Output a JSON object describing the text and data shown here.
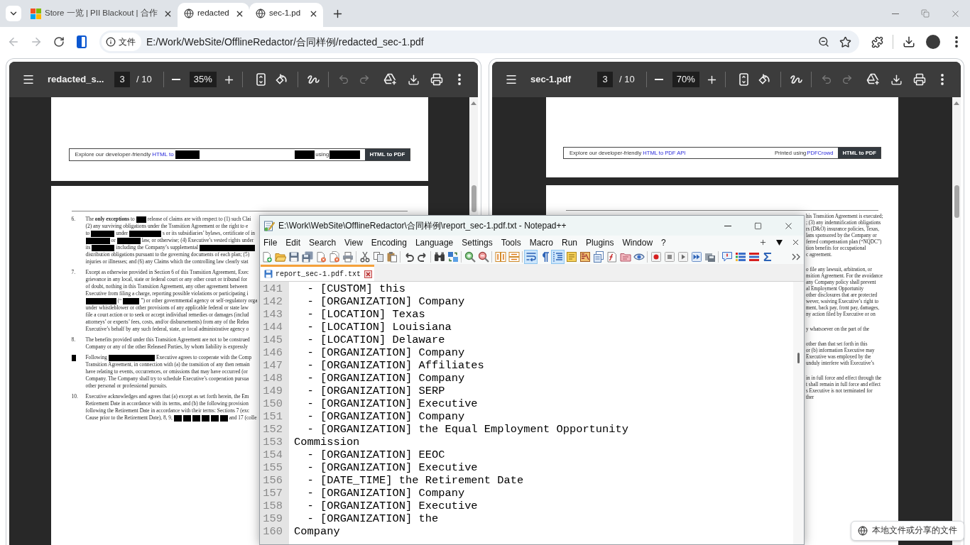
{
  "browser": {
    "tabs": [
      {
        "kind": "store",
        "title": "Store 一览 | PII Blackout | 合作",
        "selected": false
      },
      {
        "kind": "page",
        "title": "redacted",
        "selected": true
      },
      {
        "kind": "page",
        "title": "sec-1.pd",
        "selected": true
      }
    ],
    "nav_buttons": [
      {
        "kind": "back",
        "disabled": true
      },
      {
        "kind": "forward",
        "disabled": true
      },
      {
        "kind": "reload",
        "disabled": false
      }
    ],
    "address_bar": {
      "chip": "文件",
      "url": "E:/Work/WebSite/OfflineRedactor/合同样例/redacted_sec-1.pdf",
      "bookmarked": false
    }
  },
  "panes": [
    {
      "title": "redacted_s...",
      "page": "3",
      "page_total": "/ 10",
      "zoom": "35%",
      "history": [
        {
          "kind": "undo",
          "disabled": true
        },
        {
          "kind": "redo",
          "disabled": true
        }
      ],
      "footer": {
        "left": [
          "Explore our developer-friendly",
          {
            "kind": "link",
            "text": "HTML to"
          },
          {
            "kind": "redaction"
          }
        ],
        "right": [
          {
            "kind": "redaction"
          },
          "using",
          {
            "kind": "redaction"
          }
        ],
        "badge": "HTML to PDF"
      },
      "page_text": {
        "kind": "clauses",
        "paragraphs": [
          {
            "number": "6.",
            "lines": [
              [
                "The **only exceptions** to",
                {
                  "kind": "redaction"
                },
                "release of claims are with respect to (1) such Clai"
              ],
              [
                "(2) any surviving obligations under the Transition Agreement or the right to e"
              ],
              [
                "to",
                {
                  "kind": "redaction"
                },
                "under",
                {
                  "kind": "redaction"
                },
                "s or its subsidiaries’ bylaws, certificate of in"
              ],
              [
                {
                  "kind": "redaction"
                },
                "or",
                {
                  "kind": "redaction"
                },
                "law, or otherwise; (4) Executive’s vested rights under"
              ],
              [
                "its",
                {
                  "kind": "redaction"
                },
                "including the Company’s supplemental",
                {
                  "kind": "redaction"
                }
              ],
              [
                "distribution obligations pursuant to the governing documents of each plan; (5)"
              ],
              [
                "injuries or illnesses; and (6) any Claims which the controlling law clearly stat"
              ]
            ]
          },
          {
            "number": "7.",
            "lines": [
              [
                "Except as otherwise provided in Section 6 of this Transition Agreement, Exec"
              ],
              [
                "grievance in any local, state or federal court or any other court or tribunal for"
              ],
              [
                "of doubt, nothing in this Transition Agreement, any other agreement between"
              ],
              [
                "Executive from filing a charge, reporting possible violations or participating i"
              ],
              [
                {
                  "kind": "redaction"
                },
                "(“",
                {
                  "kind": "redaction"
                },
                "”) or other governmental agency or self-regulatory orga"
              ],
              [
                "under whistleblower or other provisions of any applicable federal or state law"
              ],
              [
                "file a court action or to seek or accept individual remedies or damages (includ"
              ],
              [
                "attorneys’ or experts’ fees, costs, and/or disbursements) from any of the Relea"
              ],
              [
                "Executive’s behalf by any such federal, state, or local administrative agency o"
              ]
            ]
          },
          {
            "number": "8.",
            "lines": [
              [
                "The benefits provided under this Transition Agreement are not to be construed"
              ],
              [
                "Company or any of the other Released Parties, by whom liability is expressly"
              ]
            ]
          },
          {
            "number": {
              "kind": "redaction"
            },
            "lines": [
              [
                "Following",
                {
                  "kind": "redaction"
                },
                "Executive agrees to cooperate with the Comp"
              ],
              [
                "Transition Agreement, in connection with (a) the transition of any then remain"
              ],
              [
                "have relating to events, occurrences, or omissions that may have occurred (or"
              ],
              [
                "Company. The Company shall try to schedule Executive’s cooperation pursua"
              ],
              [
                "other personal or professional pursuits."
              ]
            ]
          },
          {
            "number": "10.",
            "lines": [
              [
                "Executive acknowledges and agrees that (a) except as set forth herein, the Em"
              ],
              [
                "Retirement Date in accordance with its terms, and (b) the following provision"
              ],
              [
                "following the Retirement Date in accordance with their terms: Sections 7 (exc"
              ],
              [
                "Cause prior to the Retirement Date), 8, 9,",
                {
                  "kind": "redaction"
                },
                {
                  "kind": "redaction"
                },
                {
                  "kind": "redaction"
                },
                {
                  "kind": "redaction"
                },
                {
                  "kind": "redaction"
                },
                {
                  "kind": "redaction"
                },
                "and 17 (colle"
              ]
            ]
          }
        ]
      }
    },
    {
      "title": "sec-1.pdf",
      "page": "3",
      "page_total": "/ 10",
      "zoom": "70%",
      "history": [
        {
          "kind": "undo",
          "disabled": true
        },
        {
          "kind": "redo",
          "disabled": true
        }
      ],
      "footer": {
        "left": [
          "Explore our developer-friendly",
          {
            "kind": "link",
            "text": "HTML to PDF API"
          }
        ],
        "right": [
          "Printed using",
          {
            "kind": "link",
            "text": "PDFCrowd"
          }
        ],
        "badge": "HTML to PDF"
      },
      "page_text": {
        "kind": "fragments",
        "paragraphs": [
          {
            "lines": [
              "his Transition Agreement is executed;",
              "; (3) any indemnification obligations",
              "rs (D&O) insurance policies, Texas,",
              "lans sponsored by the Company or",
              "ferred compensation plan (“NQDC”)",
              "tion benefits for occupational",
              "c agreement."
            ]
          },
          {
            "lines": [
              "o file any lawsuit, arbitration, or",
              "nsition Agreement. For the avoidance",
              "any Company policy shall prevent",
              "al Employment Opportunity",
              "other disclosures that are protected",
              "wever, waiving Executive’s right to",
              "ment, back pay, front pay, damages,",
              "ny action filed by Executive or on"
            ]
          },
          {
            "lines": [
              "y whatsoever on the part of the"
            ]
          },
          {
            "lines": [
              "other than that set forth in this",
              "or (b) information Executive may",
              "Executive was employed by the",
              "unduly interfere with Executive’s"
            ]
          },
          {
            "lines": [
              "in in full force and effect through the",
              "t shall remain in full force and effect",
              "s Executive is not terminated for",
              "ther"
            ]
          }
        ]
      }
    }
  ],
  "notepad": {
    "title": "E:\\Work\\WebSite\\OfflineRedactor\\合同样例\\report_sec-1.pdf.txt - Notepad++",
    "menu": [
      "File",
      "Edit",
      "Search",
      "View",
      "Encoding",
      "Language",
      "Settings",
      "Tools",
      "Macro",
      "Run",
      "Plugins",
      "Window",
      "?"
    ],
    "toolbar": [
      {
        "kind": "new",
        "on": false
      },
      {
        "kind": "open",
        "on": false
      },
      {
        "kind": "save",
        "on": false
      },
      {
        "kind": "save_all",
        "on": false
      },
      {
        "kind": "close",
        "on": false
      },
      {
        "kind": "close_all",
        "on": false
      },
      {
        "kind": "print",
        "on": false
      },
      {
        "kind": "cut",
        "on": false
      },
      {
        "kind": "copy",
        "on": false
      },
      {
        "kind": "paste",
        "on": false
      },
      {
        "kind": "undo",
        "on": false
      },
      {
        "kind": "redo",
        "on": false
      },
      {
        "kind": "find",
        "on": false
      },
      {
        "kind": "replace",
        "on": false
      },
      {
        "kind": "zoom_in",
        "on": false
      },
      {
        "kind": "zoom_out",
        "on": false
      },
      {
        "kind": "sync_v",
        "on": false
      },
      {
        "kind": "sync_h",
        "on": false
      },
      {
        "kind": "wrap",
        "on": true
      },
      {
        "kind": "all_chars",
        "on": false
      },
      {
        "kind": "indent",
        "on": true
      },
      {
        "kind": "udl",
        "on": false
      },
      {
        "kind": "doc_map",
        "on": false
      },
      {
        "kind": "doc_list",
        "on": false
      },
      {
        "kind": "func_list",
        "on": false
      },
      {
        "kind": "folder_ws",
        "on": false
      },
      {
        "kind": "monitor",
        "on": false
      },
      {
        "kind": "rec",
        "on": false
      },
      {
        "kind": "stop",
        "on": false
      },
      {
        "kind": "play",
        "on": false
      },
      {
        "kind": "play_multi",
        "on": false
      },
      {
        "kind": "save_macro",
        "on": false
      },
      {
        "kind": "comment",
        "on": false
      },
      {
        "kind": "list",
        "on": false
      },
      {
        "kind": "checklist",
        "on": false
      },
      {
        "kind": "sigma",
        "on": false
      },
      {
        "kind": "more",
        "on": false
      }
    ],
    "tabs": [
      {
        "label": "report_sec-1.pdf.txt",
        "selected": true,
        "saved": true
      }
    ],
    "lines": [
      {
        "number": "141",
        "text": "  - [CUSTOM] this"
      },
      {
        "number": "142",
        "text": "  - [ORGANIZATION] Company"
      },
      {
        "number": "143",
        "text": "  - [LOCATION] Texas"
      },
      {
        "number": "144",
        "text": "  - [LOCATION] Louisiana"
      },
      {
        "number": "145",
        "text": "  - [LOCATION] Delaware"
      },
      {
        "number": "146",
        "text": "  - [ORGANIZATION] Company"
      },
      {
        "number": "147",
        "text": "  - [ORGANIZATION] Affiliates"
      },
      {
        "number": "148",
        "text": "  - [ORGANIZATION] Company"
      },
      {
        "number": "149",
        "text": "  - [ORGANIZATION] SERP"
      },
      {
        "number": "150",
        "text": "  - [ORGANIZATION] Executive"
      },
      {
        "number": "151",
        "text": "  - [ORGANIZATION] Company"
      },
      {
        "number": "152",
        "text": "  - [ORGANIZATION] the Equal Employment Opportunity"
      },
      {
        "number": "153",
        "text": "Commission"
      },
      {
        "number": "154",
        "text": "  - [ORGANIZATION] EEOC"
      },
      {
        "number": "155",
        "text": "  - [ORGANIZATION] Executive"
      },
      {
        "number": "156",
        "text": "  - [DATE_TIME] the Retirement Date"
      },
      {
        "number": "157",
        "text": "  - [ORGANIZATION] Company"
      },
      {
        "number": "158",
        "text": "  - [ORGANIZATION] Executive"
      },
      {
        "number": "159",
        "text": "  - [ORGANIZATION] the"
      },
      {
        "number": "160",
        "text": "Company"
      }
    ]
  },
  "toast": {
    "text": "本地文件或分享的文件"
  }
}
